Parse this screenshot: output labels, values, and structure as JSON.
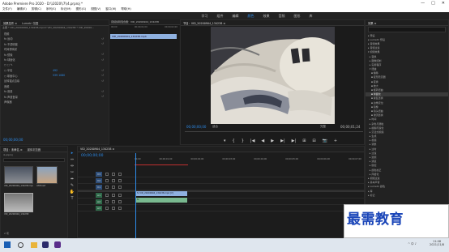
{
  "window": {
    "title": "Adobe Premiere Pro 2020 - D:\\\\2020\\\\7\\\\4.prproj *",
    "controls": [
      "—",
      "□",
      "✕"
    ]
  },
  "menu": [
    "文件(F)",
    "编辑(E)",
    "剪辑(C)",
    "序列(S)",
    "标记(M)",
    "图形(G)",
    "视图(V)",
    "窗口(W)",
    "帮助(H)"
  ],
  "topnav": {
    "items": [
      "学习",
      "组件",
      "编辑",
      "颜色",
      "效果",
      "音频",
      "图形",
      "库"
    ],
    "active": 3
  },
  "effect_controls": {
    "tabs": [
      "效果控件 ≡",
      "Lumetri 范围",
      "源：VID_20200904_134238.mp4",
      "音频剪辑混合器：VID_20200904_134238"
    ],
    "source_line": "主要 * VID_20200904_134238.mp4 ▾  VID_20200904_134238 * VID_20200...",
    "rows": [
      {
        "label": "视频",
        "value": "",
        "kf": ""
      },
      {
        "label": "fx  运动",
        "value": "",
        "kf": "↺"
      },
      {
        "label": "fx  不透明度",
        "value": "",
        "kf": "↺"
      },
      {
        "label": "    时间重映射",
        "value": "",
        "kf": ""
      },
      {
        "label": "fx  镜像",
        "value": "",
        "kf": "↺"
      },
      {
        "label": "fx  球面化",
        "value": "",
        "kf": "↺"
      },
      {
        "label": "    ○ □ ✎",
        "value": "",
        "kf": ""
      },
      {
        "label": "  ○ 半径",
        "value": "492",
        "kf": "↺"
      },
      {
        "label": "  ○ 球面中心",
        "value": "539    1080",
        "kf": "↺"
      },
      {
        "label": "    反转锚点边缘",
        "value": "",
        "kf": "↺"
      },
      {
        "label": "音频",
        "value": "",
        "kf": ""
      },
      {
        "label": "fx  音量",
        "value": "",
        "kf": "↺"
      },
      {
        "label": "fx  声道音量",
        "value": "",
        "kf": "↺"
      },
      {
        "label": "    声像器",
        "value": "",
        "kf": ""
      }
    ],
    "timecode": "00;00;00;00"
  },
  "mini_timeline": {
    "ruler": [
      "00;00",
      "00;00;01;00",
      "00;00;02;00"
    ],
    "clip": "VID_20200904_134238.mp4"
  },
  "program": {
    "title": "节目：VID_20200904_134238 ≡",
    "timecode": "00;00;00;00",
    "fit": "适合",
    "quality": "完整",
    "duration": "00;00;01;24",
    "transport": [
      "▾",
      "|",
      "{",
      "}",
      "|◀",
      "◀|",
      "◀",
      "▶",
      "▶|",
      "▶|",
      "⊞",
      "⊟",
      "⊡",
      "📷",
      "⊕",
      "+"
    ]
  },
  "effects_panel": {
    "title": "效果 ≡",
    "items": [
      "▸ 预设",
      "▸ Lumetri 预设",
      "▸ 音频效果",
      "▸ 音频过渡",
      "▾ 视频效果",
      "  ▸ 变换",
      "  ▸ 图像控制",
      "  ▸ 实用程序",
      "  ▾ 扭曲",
      "    ▪ 偏移",
      "    ▪ 变形稳定器",
      "    ▪ 变换",
      "    ▪ 放大",
      "    ▪ 旋转扭曲",
      "    ▪ 球面化",
      "    ▪ 紊乱置换",
      "    ▪ 边角定位",
      "    ▪ 镜像",
      "    ▪ 镜头扭曲",
      "    ▪ 湍流置换",
      "  ▸ 时间",
      "  ▸ 杂色与颗粒",
      "  ▸ 模糊与锐化",
      "  ▸ 沉浸式视频",
      "  ▸ 生成",
      "  ▸ 视频",
      "  ▸ 调整",
      "  ▸ 过时",
      "  ▸ 过渡",
      "  ▸ 透视",
      "  ▸ 通道",
      "  ▸ 键控",
      "  ▸ 颜色校正",
      "  ▸ 风格化",
      "▸ 视频过渡",
      "▸ 基本声音",
      "▸ Lumetri 颜色",
      "▸ 库",
      "▸ 标记"
    ],
    "selected_index": 14,
    "footer": "基本图形"
  },
  "project": {
    "tabs": [
      "项目：未命名 ≡",
      "媒体浏览器"
    ],
    "search": "4.prproj",
    "files": [
      "VID_20200904_134238.mp4",
      "4765.Gif",
      "VID_20200904_134238"
    ],
    "count": "2 项"
  },
  "timeline": {
    "title": "VID_20200904_134238 ≡",
    "timecode": "00;00;00;00",
    "ruler": [
      "00;00",
      "00;00;01;00",
      "00;00;02;00",
      "00;00;03;00",
      "00;00;04;00",
      "00;00;05;00",
      "00;00;06;00",
      "00;00;07;00"
    ],
    "tracks": [
      "V3",
      "V2",
      "V1",
      "A1",
      "A2",
      "A3"
    ],
    "clip_video": "fx VID_20200904_134238.mp4 [V]",
    "clip_audio": "fx"
  },
  "tools": [
    "▸",
    "⇔",
    "⇹",
    "◇",
    "✂",
    "⬌",
    "✎",
    "✋",
    "T"
  ],
  "taskbar": {
    "time": "11:08",
    "date": "2021/11/8",
    "tray": "^ 中 ♪"
  },
  "watermark": "最需教育"
}
